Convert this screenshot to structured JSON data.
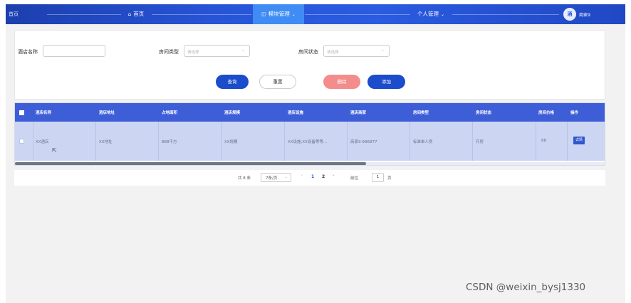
{
  "topbar": {
    "brand": "首页",
    "nav": [
      {
        "icon": "home-icon",
        "glyph": "⌂",
        "label": "首页"
      },
      {
        "icon": "grid-icon",
        "glyph": "◫",
        "label": "模块管理",
        "active": true
      },
      {
        "icon": "",
        "glyph": "",
        "label": "个人管理"
      }
    ],
    "user": {
      "avatar": "酒",
      "name": "商家9"
    }
  },
  "search": {
    "hotel_name_label": "酒店名称",
    "hotel_name_value": "",
    "room_type_label": "房间类型",
    "room_type_placeholder": "请选择",
    "room_status_label": "房间状态",
    "room_status_placeholder": "请选择",
    "query_button": "查询",
    "reset_button": "重置",
    "delete_button": "删除",
    "add_button": "添加"
  },
  "table": {
    "columns": [
      "酒店名称",
      "酒店地址",
      "占地面积",
      "酒店规模",
      "酒店设施",
      "酒店商家",
      "房间类型",
      "房间状态",
      "房间价格",
      "操作"
    ],
    "rows": [
      {
        "name": "XX酒店",
        "address": "XX地址",
        "area": "888平方",
        "scale": "XX规模",
        "facilities": "XX设施,XX设备等等...",
        "merchant": "商家9-996877",
        "room_type": "标准单人房",
        "room_status": "开房",
        "price": "88",
        "action": "详情"
      }
    ]
  },
  "pager": {
    "total": "共 8 条",
    "page_size": "7条/页",
    "prev": "‹",
    "pages": [
      "1",
      "2"
    ],
    "current_page": "1",
    "next": "›",
    "goto_label": "前往",
    "goto_value": "1",
    "goto_suffix": "页"
  },
  "watermark": "CSDN @weixin_bysj1330",
  "colors": {
    "topbar": "#2755d8",
    "active_nav": "#3f8cf5",
    "table_header": "#3e5ed8",
    "table_row": "#ccd5f1",
    "primary_button": "#1a4ccc",
    "danger_button": "#f48c8c"
  }
}
